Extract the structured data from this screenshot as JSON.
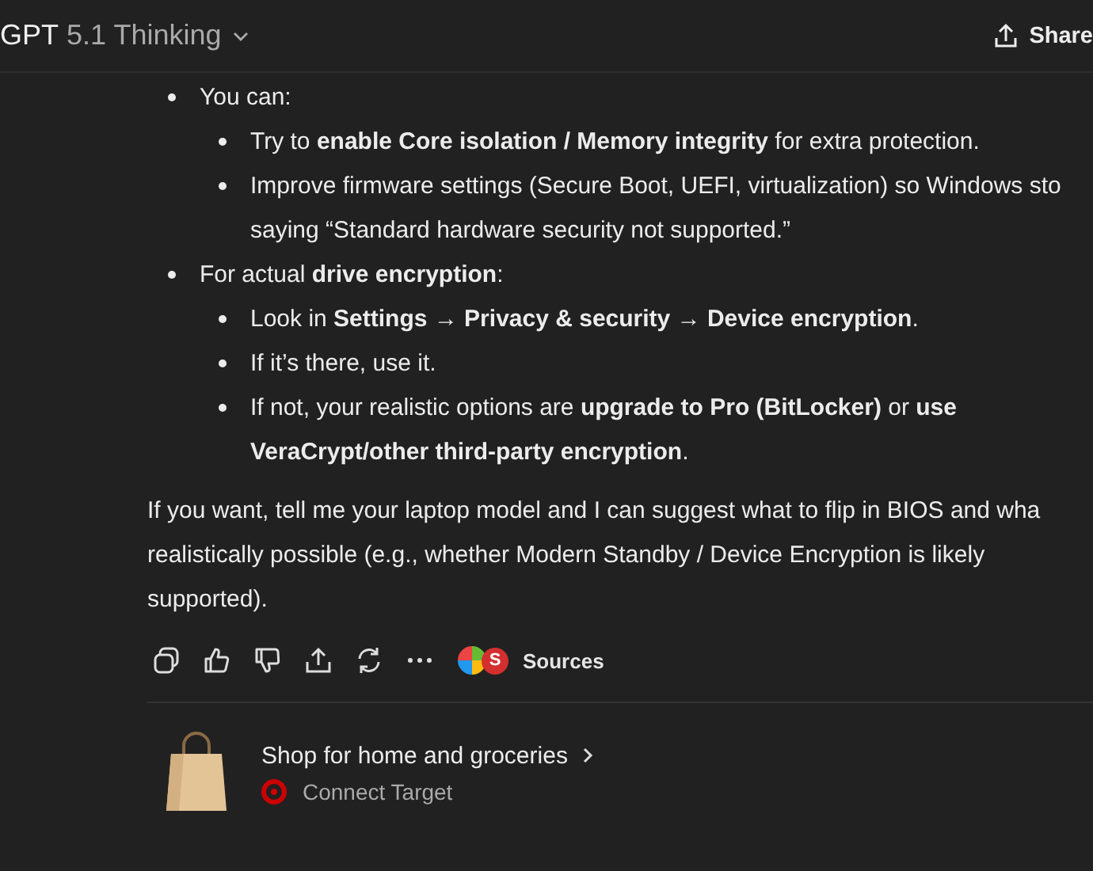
{
  "header": {
    "brand": "GPT",
    "model": "5.1 Thinking",
    "share": "Share"
  },
  "list": [
    {
      "lines": [
        "You can:"
      ],
      "children": [
        {
          "lines": [
            "Try to **enable Core isolation / Memory integrity** for extra protection."
          ]
        },
        {
          "lines": [
            "Improve firmware settings (Secure Boot, UEFI, virtualization) so Windows sto",
            "saying “Standard hardware security not supported.”"
          ]
        }
      ]
    },
    {
      "lines": [
        "For actual **drive encryption**:"
      ],
      "children": [
        {
          "lines": [
            "Look in **Settings → Privacy & security → Device encryption**."
          ]
        },
        {
          "lines": [
            "If it’s there, use it."
          ]
        },
        {
          "lines": [
            "If not, your realistic options are **upgrade to Pro (BitLocker)** or **use**",
            "**VeraCrypt/other third-party encryption**."
          ]
        }
      ]
    }
  ],
  "paragraph": [
    "If you want, tell me your laptop model and I can suggest what to flip in BIOS and wha",
    "realistically possible (e.g., whether Modern Standby / Device Encryption is likely",
    "supported)."
  ],
  "sources": {
    "label": "Sources",
    "badge": "S"
  },
  "shop": {
    "title": "Shop for home and groceries",
    "connect": "Connect Target"
  }
}
